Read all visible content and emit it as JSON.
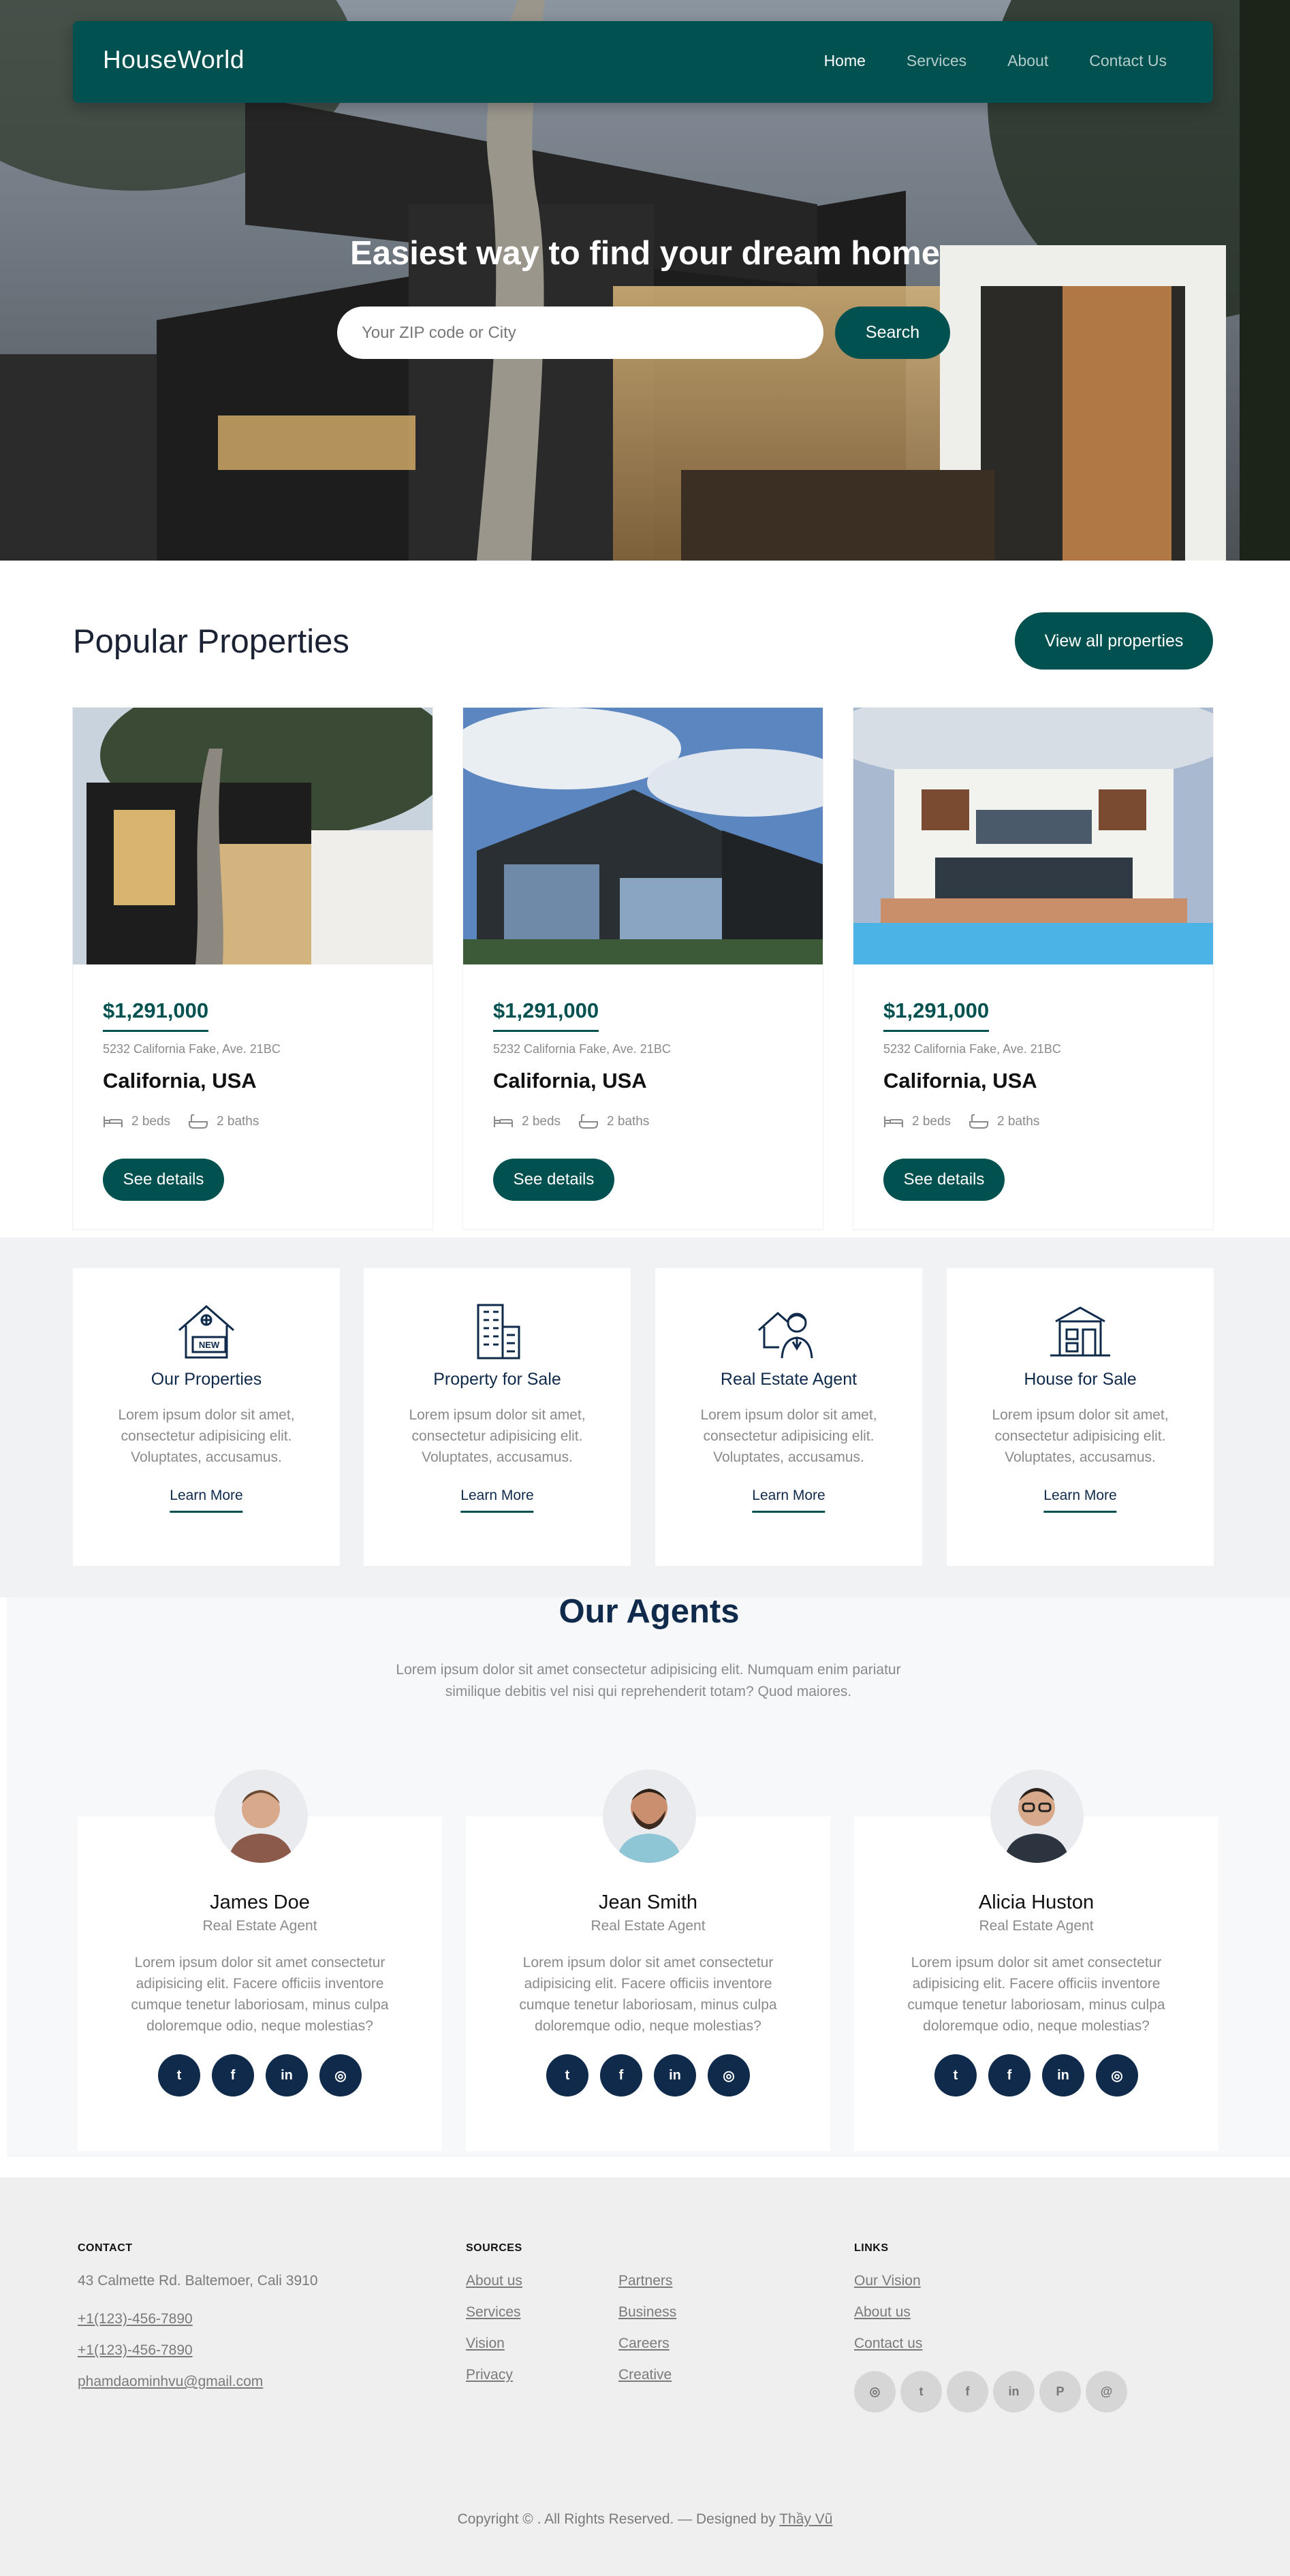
{
  "brand": "HouseWorld",
  "nav": [
    {
      "label": "Home",
      "active": true
    },
    {
      "label": "Services",
      "active": false
    },
    {
      "label": "About",
      "active": false
    },
    {
      "label": "Contact Us",
      "active": false
    }
  ],
  "hero": {
    "title": "Easiest way to find your dream home",
    "search_placeholder": "Your ZIP code or City",
    "search_button": "Search"
  },
  "popular": {
    "title": "Popular Properties",
    "view_all": "View all properties",
    "properties": [
      {
        "price": "$1,291,000",
        "address": "5232 California Fake, Ave. 21BC",
        "city": "California, USA",
        "beds": "2 beds",
        "baths": "2 baths",
        "button": "See details"
      },
      {
        "price": "$1,291,000",
        "address": "5232 California Fake, Ave. 21BC",
        "city": "California, USA",
        "beds": "2 beds",
        "baths": "2 baths",
        "button": "See details"
      },
      {
        "price": "$1,291,000",
        "address": "5232 California Fake, Ave. 21BC",
        "city": "California, USA",
        "beds": "2 beds",
        "baths": "2 baths",
        "button": "See details"
      }
    ]
  },
  "features": [
    {
      "title": "Our Properties",
      "text": "Lorem ipsum dolor sit amet, consectetur adipisicing elit. Voluptates, accusamus.",
      "link": "Learn More",
      "icon": "house-new-icon",
      "icon_text": "NEW"
    },
    {
      "title": "Property for Sale",
      "text": "Lorem ipsum dolor sit amet, consectetur adipisicing elit. Voluptates, accusamus.",
      "link": "Learn More",
      "icon": "building-icon"
    },
    {
      "title": "Real Estate Agent",
      "text": "Lorem ipsum dolor sit amet, consectetur adipisicing elit. Voluptates, accusamus.",
      "link": "Learn More",
      "icon": "agent-icon"
    },
    {
      "title": "House for Sale",
      "text": "Lorem ipsum dolor sit amet, consectetur adipisicing elit. Voluptates, accusamus.",
      "link": "Learn More",
      "icon": "house-sale-icon"
    }
  ],
  "agents": {
    "title": "Our Agents",
    "intro": "Lorem ipsum dolor sit amet consectetur adipisicing elit. Numquam enim pariatur similique debitis vel nisi qui reprehenderit totam? Quod maiores.",
    "list": [
      {
        "name": "James Doe",
        "role": "Real Estate Agent",
        "bio": "Lorem ipsum dolor sit amet consectetur adipisicing elit. Facere officiis inventore cumque tenetur laboriosam, minus culpa doloremque odio, neque molestias?"
      },
      {
        "name": "Jean Smith",
        "role": "Real Estate Agent",
        "bio": "Lorem ipsum dolor sit amet consectetur adipisicing elit. Facere officiis inventore cumque tenetur laboriosam, minus culpa doloremque odio, neque molestias?"
      },
      {
        "name": "Alicia Huston",
        "role": "Real Estate Agent",
        "bio": "Lorem ipsum dolor sit amet consectetur adipisicing elit. Facere officiis inventore cumque tenetur laboriosam, minus culpa doloremque odio, neque molestias?"
      }
    ],
    "social_icons": [
      "twitter-icon",
      "facebook-icon",
      "linkedin-icon",
      "instagram-icon"
    ]
  },
  "footer": {
    "contact_head": "CONTACT",
    "address": "43 Calmette Rd. Baltemoer, Cali 3910",
    "phone1": "+1(123)-456-7890",
    "phone2": "+1(123)-456-7890",
    "email": "phamdaominhvu@gmail.com",
    "sources_head": "SOURCES",
    "sources_col1": [
      "About us",
      "Services",
      "Vision",
      "Privacy"
    ],
    "sources_col2": [
      "Partners",
      "Business",
      "Careers",
      "Creative"
    ],
    "links_head": "LINKS",
    "links": [
      "Our Vision",
      "About us",
      "Contact us"
    ],
    "social_icons": [
      "instagram-icon",
      "twitter-icon",
      "facebook-icon",
      "linkedin-icon",
      "pinterest-icon",
      "dribbble-icon"
    ],
    "copyright_prefix": "Copyright © . All Rights Reserved. — Designed by",
    "designer": "Thầy Vũ"
  },
  "colors": {
    "primary": "#00514f",
    "navy": "#0f2a4a",
    "footer_bg": "#efefef",
    "section_bg": "#f1f2f4"
  }
}
